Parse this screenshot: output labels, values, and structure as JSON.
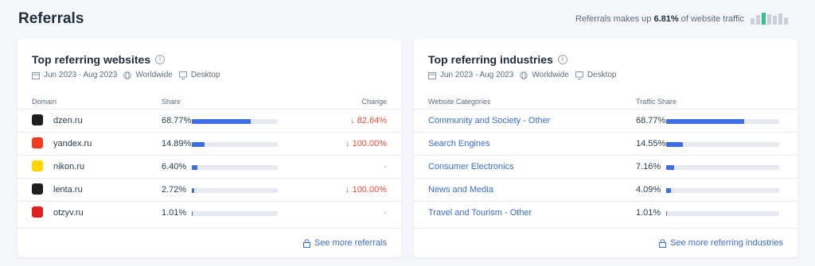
{
  "page": {
    "title": "Referrals"
  },
  "traffic_note": {
    "prefix": "Referrals makes up",
    "value": "6.81%",
    "suffix": "of website traffic",
    "mini_bar_levels": [
      0.55,
      0.8,
      1.0,
      0.85,
      0.7,
      0.9,
      0.6
    ],
    "mini_bar_highlight_index": 2,
    "highlight_color": "#34c28b"
  },
  "websites": {
    "title": "Top referring websites",
    "meta": {
      "date": "Jun 2023 - Aug 2023",
      "region": "Worldwide",
      "device": "Desktop"
    },
    "columns": {
      "domain": "Domain",
      "share": "Share",
      "change": "Change"
    },
    "rows": [
      {
        "domain": "dzen.ru",
        "share": "68.77%",
        "share_fraction": 0.6877,
        "change": "↓ 82.64%",
        "change_dir": "down",
        "icon": "dzen-icon",
        "icon_color": "#1e1e1e"
      },
      {
        "domain": "yandex.ru",
        "share": "14.89%",
        "share_fraction": 0.1489,
        "change": "↓ 100.00%",
        "change_dir": "down",
        "icon": "yandex-icon",
        "icon_color": "#f33b1e"
      },
      {
        "domain": "nikon.ru",
        "share": "6.40%",
        "share_fraction": 0.064,
        "change": "-",
        "change_dir": "none",
        "icon": "nikon-icon",
        "icon_color": "#ffd400"
      },
      {
        "domain": "lenta.ru",
        "share": "2.72%",
        "share_fraction": 0.0272,
        "change": "↓ 100.00%",
        "change_dir": "down",
        "icon": "lenta-icon",
        "icon_color": "#1e1e1e"
      },
      {
        "domain": "otzyv.ru",
        "share": "1.01%",
        "share_fraction": 0.0101,
        "change": "-",
        "change_dir": "none",
        "icon": "otzyv-icon",
        "icon_color": "#e02020"
      }
    ],
    "see_more": "See more referrals"
  },
  "industries": {
    "title": "Top referring industries",
    "meta": {
      "date": "Jun 2023 - Aug 2023",
      "region": "Worldwide",
      "device": "Desktop"
    },
    "columns": {
      "category": "Website Categories",
      "share": "Traffic Share"
    },
    "rows": [
      {
        "category": "Community and Society - Other",
        "share": "68.77%",
        "share_fraction": 0.6877
      },
      {
        "category": "Search Engines",
        "share": "14.55%",
        "share_fraction": 0.1455
      },
      {
        "category": "Consumer Electronics",
        "share": "7.16%",
        "share_fraction": 0.0716
      },
      {
        "category": "News and Media",
        "share": "4.09%",
        "share_fraction": 0.0409
      },
      {
        "category": "Travel and Tourism - Other",
        "share": "1.01%",
        "share_fraction": 0.0101
      }
    ],
    "see_more": "See more referring industries"
  },
  "colors": {
    "accent": "#3d6ee6",
    "link": "#3b6cd4",
    "negative": "#e84b3c"
  }
}
